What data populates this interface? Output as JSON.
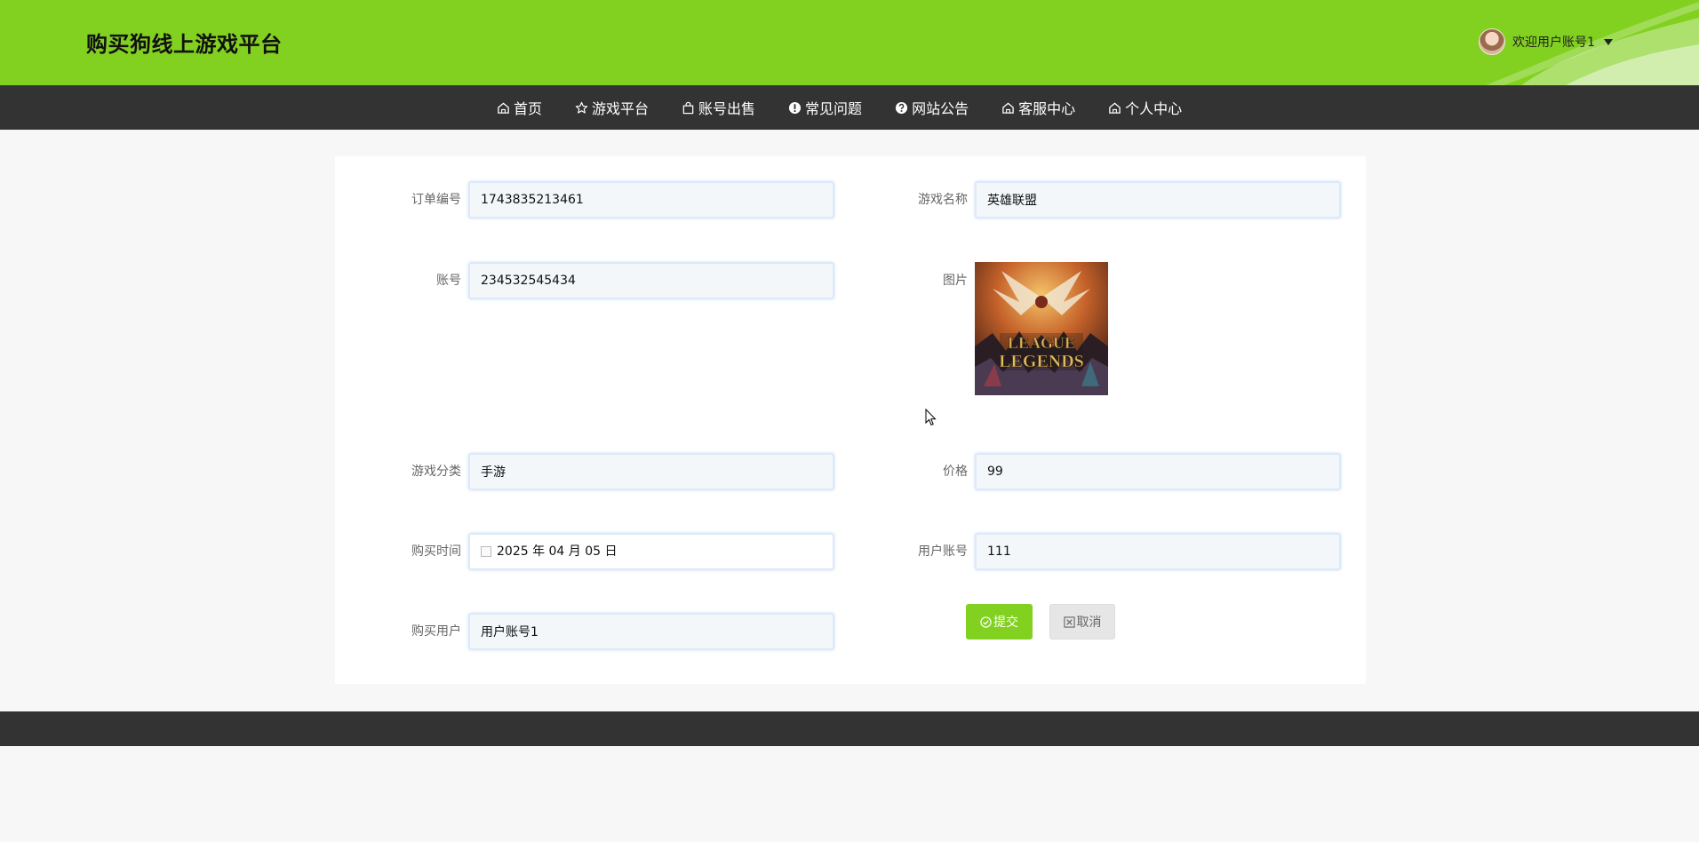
{
  "header": {
    "brand": "购买狗线上游戏平台",
    "user_label": "欢迎用户账号1"
  },
  "nav": {
    "items": [
      {
        "label": "首页",
        "icon": "home-icon"
      },
      {
        "label": "游戏平台",
        "icon": "star-icon"
      },
      {
        "label": "账号出售",
        "icon": "bag-icon"
      },
      {
        "label": "常见问题",
        "icon": "exclamation-circle-icon"
      },
      {
        "label": "网站公告",
        "icon": "question-circle-icon"
      },
      {
        "label": "客服中心",
        "icon": "home-icon"
      },
      {
        "label": "个人中心",
        "icon": "home-icon"
      }
    ]
  },
  "form": {
    "order_no": {
      "label": "订单编号",
      "value": "1743835213461"
    },
    "game_name": {
      "label": "游戏名称",
      "value": "英雄联盟"
    },
    "account": {
      "label": "账号",
      "value": "234532545434"
    },
    "image": {
      "label": "图片",
      "logo_line1": "LEAGUE",
      "logo_line2": "LEGENDS"
    },
    "category": {
      "label": "游戏分类",
      "value": "手游"
    },
    "price": {
      "label": "价格",
      "value": "99"
    },
    "buy_time": {
      "label": "购买时间",
      "value": "2025 年 04 月 05 日"
    },
    "user_account": {
      "label": "用户账号",
      "value": "111"
    },
    "buy_user": {
      "label": "购买用户",
      "value": "用户账号1"
    },
    "submit_label": "提交",
    "cancel_label": "取消"
  },
  "colors": {
    "brand_green": "#82d020",
    "nav_dark": "#333333",
    "page_bg": "#f7f7f7"
  }
}
